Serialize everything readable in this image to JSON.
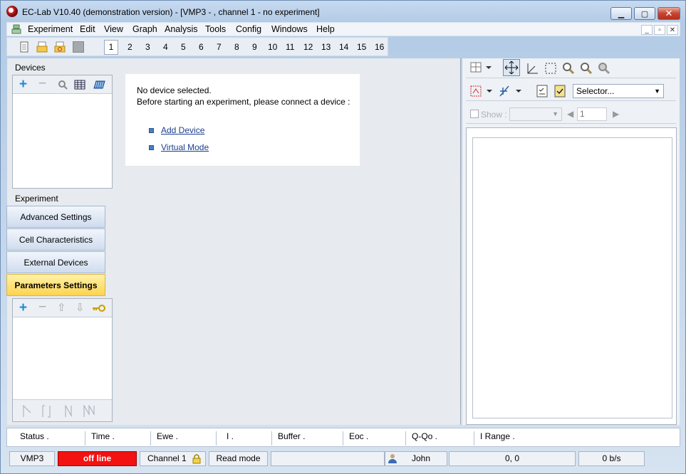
{
  "window": {
    "title": "EC-Lab V10.40 (demonstration version) - [VMP3 - , channel 1 - no experiment]",
    "buttons": [
      "_",
      "□",
      "✕"
    ]
  },
  "menu": {
    "items": [
      "Experiment",
      "Edit",
      "View",
      "Graph",
      "Analysis",
      "Tools",
      "Config",
      "Windows",
      "Help"
    ],
    "mdi_buttons": [
      "_",
      "▫",
      "✕"
    ]
  },
  "toolbar": {
    "channels": [
      "1",
      "2",
      "3",
      "4",
      "5",
      "6",
      "7",
      "8",
      "9",
      "10",
      "11",
      "12",
      "13",
      "14",
      "15",
      "16"
    ],
    "selected_channel": "1"
  },
  "left": {
    "devices_label": "Devices",
    "experiment_label": "Experiment",
    "experiment_buttons": [
      "Advanced Settings",
      "Cell Characteristics",
      "External Devices",
      "Parameters Settings"
    ]
  },
  "center": {
    "line1": "No device selected.",
    "line2": "Before starting an experiment, please connect a device :",
    "link_add_device": "Add Device",
    "link_virtual_mode": "Virtual Mode"
  },
  "right": {
    "selector_value": "Selector...",
    "show_label": "Show :",
    "page_value": "1"
  },
  "status_header": {
    "cells": [
      "Status   .",
      "Time   .",
      "Ewe   .",
      "I   .",
      "Buffer   .",
      "Eoc   .",
      "Q-Qo   .",
      "I Range   ."
    ]
  },
  "statusbar": {
    "device": "VMP3",
    "connection": "off line",
    "channel": "Channel 1",
    "mode": "Read mode",
    "user": "John",
    "coords": "0, 0",
    "rate": "0 b/s"
  },
  "colors": {
    "offline": "#f21212",
    "active_tab": "#fcd34f",
    "link": "#1a3f8f"
  }
}
